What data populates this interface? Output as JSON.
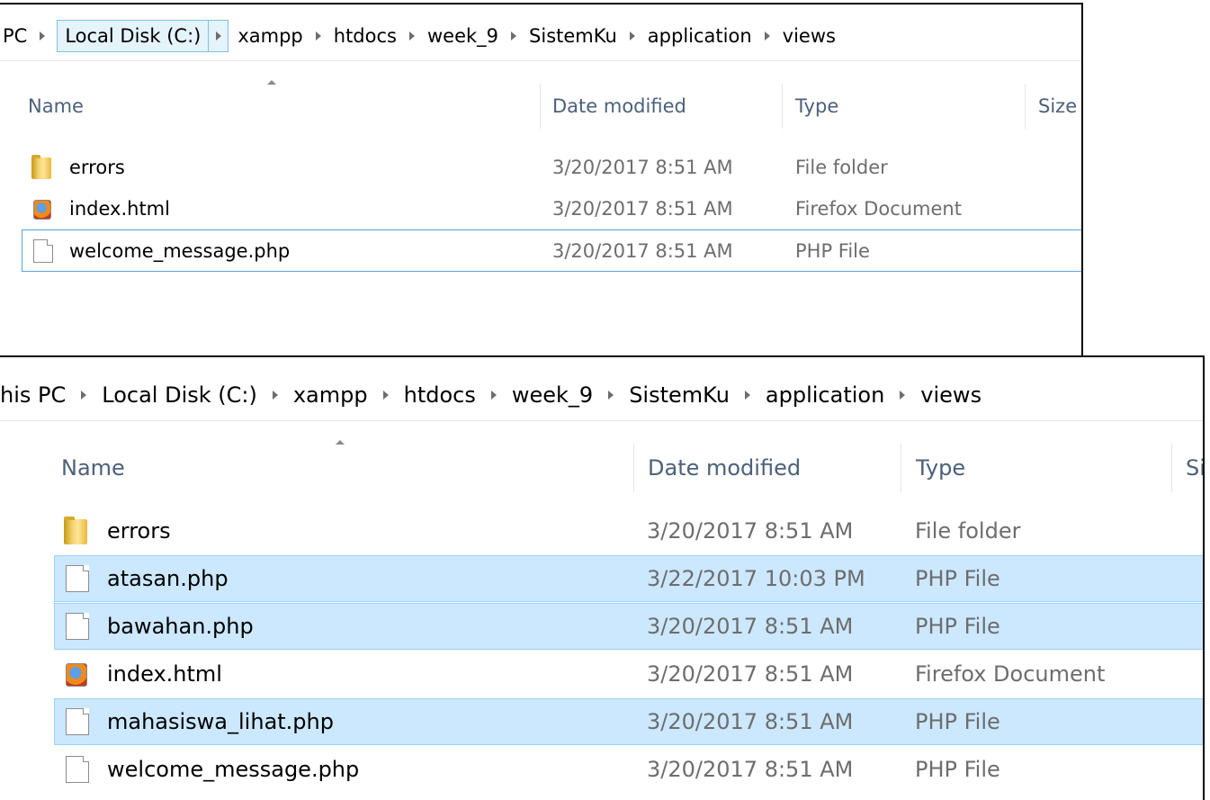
{
  "top_window": {
    "breadcrumb": [
      "PC",
      "Local Disk (C:)",
      "xampp",
      "htdocs",
      "week_9",
      "SistemKu",
      "application",
      "views"
    ],
    "columns": {
      "name": "Name",
      "date": "Date modified",
      "type": "Type",
      "size": "Size"
    },
    "files": [
      {
        "name": "errors",
        "icon": "folder-icon",
        "date": "3/20/2017 8:51 AM",
        "type": "File folder"
      },
      {
        "name": "index.html",
        "icon": "firefox-document-icon",
        "date": "3/20/2017 8:51 AM",
        "type": "Firefox Document"
      },
      {
        "name": "welcome_message.php",
        "icon": "php-file-icon",
        "date": "3/20/2017 8:51 AM",
        "type": "PHP File",
        "focused": true
      }
    ]
  },
  "bottom_window": {
    "breadcrumb": [
      "his PC",
      "Local Disk (C:)",
      "xampp",
      "htdocs",
      "week_9",
      "SistemKu",
      "application",
      "views"
    ],
    "columns": {
      "name": "Name",
      "date": "Date modified",
      "type": "Type",
      "size": "Si"
    },
    "files": [
      {
        "name": "errors",
        "icon": "folder-icon",
        "date": "3/20/2017 8:51 AM",
        "type": "File folder"
      },
      {
        "name": "atasan.php",
        "icon": "php-file-icon",
        "date": "3/22/2017 10:03 PM",
        "type": "PHP File",
        "selected": true
      },
      {
        "name": "bawahan.php",
        "icon": "php-file-icon",
        "date": "3/20/2017 8:51 AM",
        "type": "PHP File",
        "selected": true
      },
      {
        "name": "index.html",
        "icon": "firefox-document-icon",
        "date": "3/20/2017 8:51 AM",
        "type": "Firefox Document"
      },
      {
        "name": "mahasiswa_lihat.php",
        "icon": "php-file-icon",
        "date": "3/20/2017 8:51 AM",
        "type": "PHP File",
        "selected": true
      },
      {
        "name": "welcome_message.php",
        "icon": "php-file-icon",
        "date": "3/20/2017 8:51 AM",
        "type": "PHP File"
      }
    ]
  },
  "colors": {
    "selection_fill": "#cce8ff",
    "selection_border": "#99d1ff",
    "focus_border": "#57a3e0",
    "header_text": "#4c607a",
    "meta_text": "#6d6d6d"
  }
}
